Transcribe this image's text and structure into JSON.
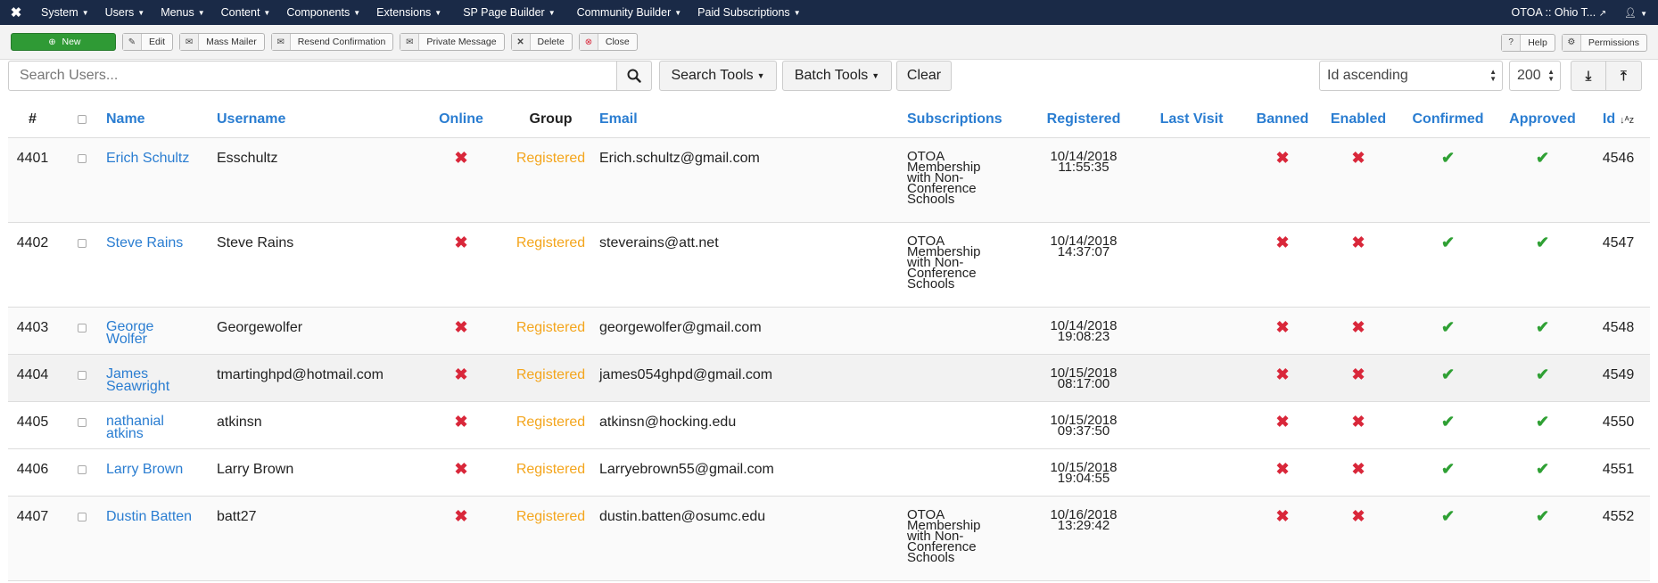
{
  "nav": {
    "logo": "✖",
    "items": [
      "System",
      "Users",
      "Menus",
      "Content",
      "Components",
      "Extensions",
      "SP Page Builder",
      "Community Builder",
      "Paid Subscriptions"
    ],
    "site_name": "OTOA :: Ohio T...",
    "user_icon": "user-icon"
  },
  "toolbar": {
    "new": "New",
    "edit": "Edit",
    "mass_mailer": "Mass Mailer",
    "resend": "Resend Confirmation",
    "private_message": "Private Message",
    "delete": "Delete",
    "close": "Close",
    "help": "Help",
    "permissions": "Permissions"
  },
  "search": {
    "placeholder": "Search Users...",
    "search_tools": "Search Tools",
    "batch_tools": "Batch Tools",
    "clear": "Clear",
    "ordering": "Id ascending",
    "limit": "200"
  },
  "table": {
    "headers": {
      "num": "#",
      "name": "Name",
      "username": "Username",
      "online": "Online",
      "group": "Group",
      "email": "Email",
      "subscriptions": "Subscriptions",
      "registered": "Registered",
      "last_visit": "Last Visit",
      "banned": "Banned",
      "enabled": "Enabled",
      "confirmed": "Confirmed",
      "approved": "Approved",
      "id": "Id"
    },
    "rows": [
      {
        "num": "4401",
        "name1": "Erich Schultz",
        "name2": "",
        "username": "Esschultz",
        "group": "Registered",
        "email": "Erich.schultz@gmail.com",
        "sub": [
          "OTOA",
          "Membership",
          "with Non-",
          "Conference",
          "Schools"
        ],
        "reg_date": "10/14/2018",
        "reg_time": "11:55:35",
        "id": "4546"
      },
      {
        "num": "4402",
        "name1": "Steve Rains",
        "name2": "",
        "username": "Steve Rains",
        "group": "Registered",
        "email": "steverains@att.net",
        "sub": [
          "OTOA",
          "Membership",
          "with Non-",
          "Conference",
          "Schools"
        ],
        "reg_date": "10/14/2018",
        "reg_time": "14:37:07",
        "id": "4547"
      },
      {
        "num": "4403",
        "name1": "George",
        "name2": "Wolfer",
        "username": "Georgewolfer",
        "group": "Registered",
        "email": "georgewolfer@gmail.com",
        "sub": [],
        "reg_date": "10/14/2018",
        "reg_time": "19:08:23",
        "id": "4548"
      },
      {
        "num": "4404",
        "name1": "James",
        "name2": "Seawright",
        "username": "tmartinghpd@hotmail.com",
        "group": "Registered",
        "email": "james054ghpd@gmail.com",
        "sub": [],
        "reg_date": "10/15/2018",
        "reg_time": "08:17:00",
        "id": "4549"
      },
      {
        "num": "4405",
        "name1": "nathanial",
        "name2": "atkins",
        "username": "atkinsn",
        "group": "Registered",
        "email": "atkinsn@hocking.edu",
        "sub": [],
        "reg_date": "10/15/2018",
        "reg_time": "09:37:50",
        "id": "4550"
      },
      {
        "num": "4406",
        "name1": "Larry Brown",
        "name2": "",
        "username": "Larry Brown",
        "group": "Registered",
        "email": "Larryebrown55@gmail.com",
        "sub": [],
        "reg_date": "10/15/2018",
        "reg_time": "19:04:55",
        "id": "4551"
      },
      {
        "num": "4407",
        "name1": "Dustin Batten",
        "name2": "",
        "username": "batt27",
        "group": "Registered",
        "email": "dustin.batten@osumc.edu",
        "sub": [
          "OTOA",
          "Membership",
          "with Non-",
          "Conference",
          "Schools"
        ],
        "reg_date": "10/16/2018",
        "reg_time": "13:29:42",
        "id": "4552"
      }
    ]
  },
  "colors": {
    "navbar": "#1a2a47",
    "link": "#2a7dd1",
    "group": "#f4a51c",
    "cross": "#d9273a",
    "check": "#2fa034",
    "new_button": "#2f9a35"
  }
}
